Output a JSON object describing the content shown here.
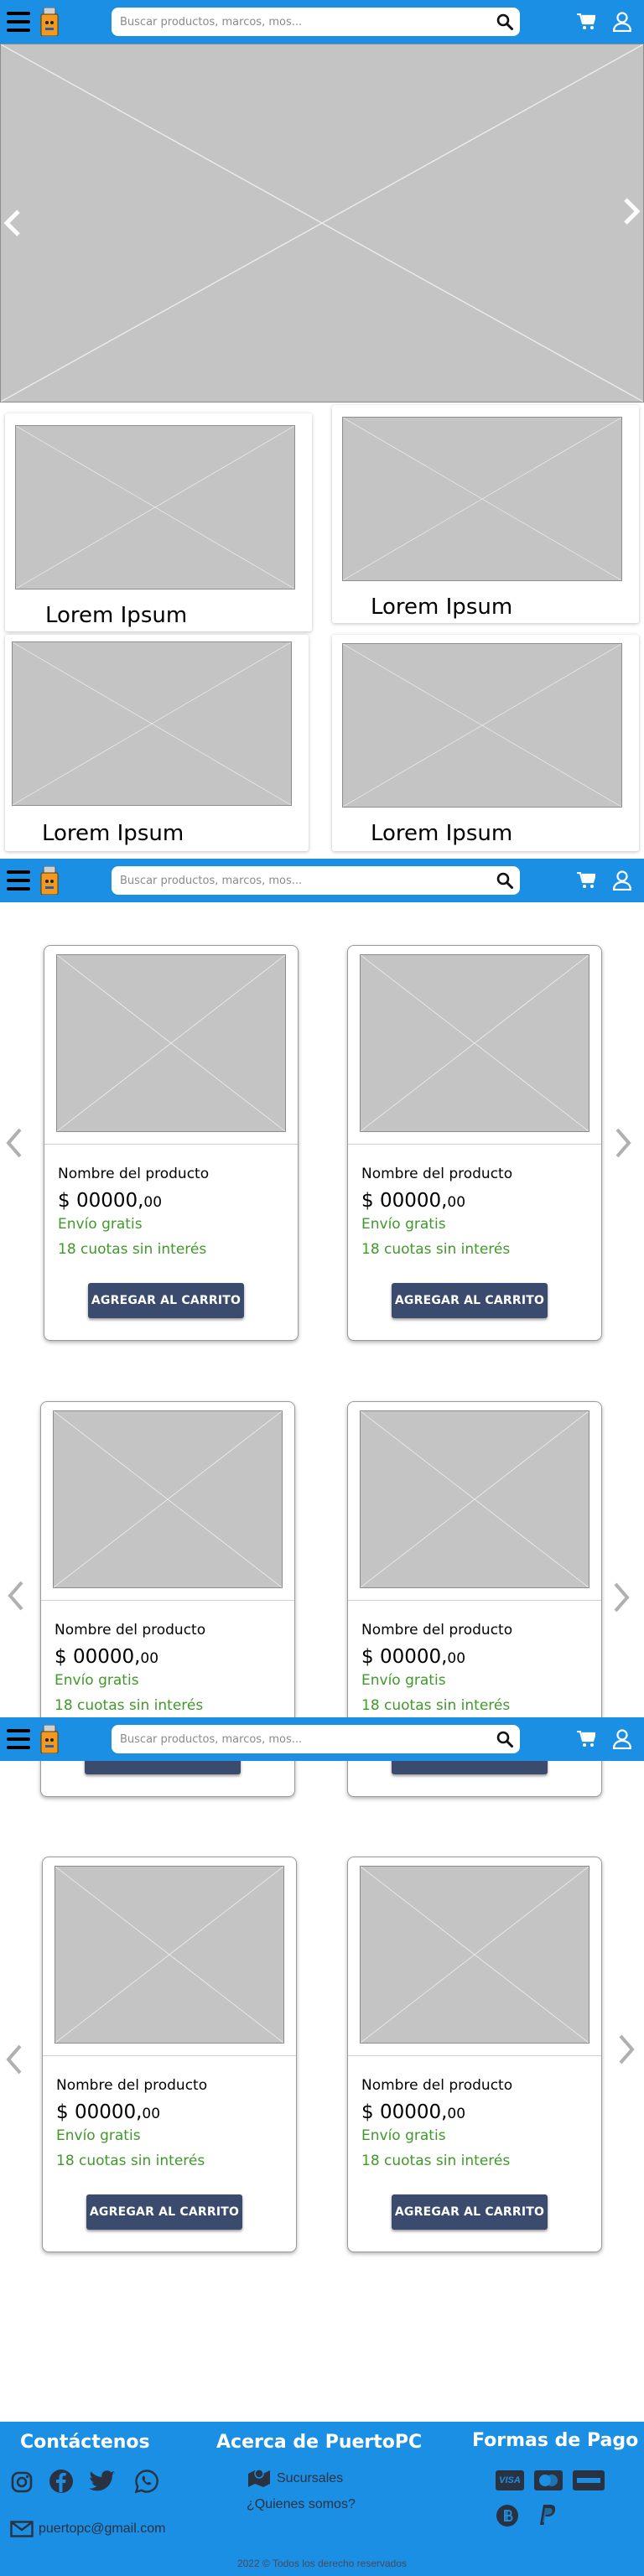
{
  "header": {
    "search_placeholder": "Buscar productos, marcos, mos..."
  },
  "categories": [
    {
      "label": "Lorem Ipsum"
    },
    {
      "label": "Lorem Ipsum"
    },
    {
      "label": "Lorem Ipsum"
    },
    {
      "label": "Lorem Ipsum"
    }
  ],
  "product": {
    "name": "Nombre del producto",
    "price_main": "$ 00000,",
    "price_cents": "00",
    "shipping": "Envío gratis",
    "installments": "18 cuotas sin interés",
    "add_to_cart": "AGREGAR AL CARRITO"
  },
  "footer": {
    "contact_title": "Contáctenos",
    "about_title": "Acerca de PuertoPC",
    "payment_title": "Formas de Pago",
    "branches": "Sucursales",
    "who_we_are": "¿Quienes somos?",
    "email": "puertopc@gmail.com",
    "copyright": "2022 © Todos los derecho reservados",
    "visa": "VISA"
  },
  "colors": {
    "brand_blue": "#1a8fe3",
    "button": "#3b4b6e",
    "green": "#3f9a2a"
  }
}
